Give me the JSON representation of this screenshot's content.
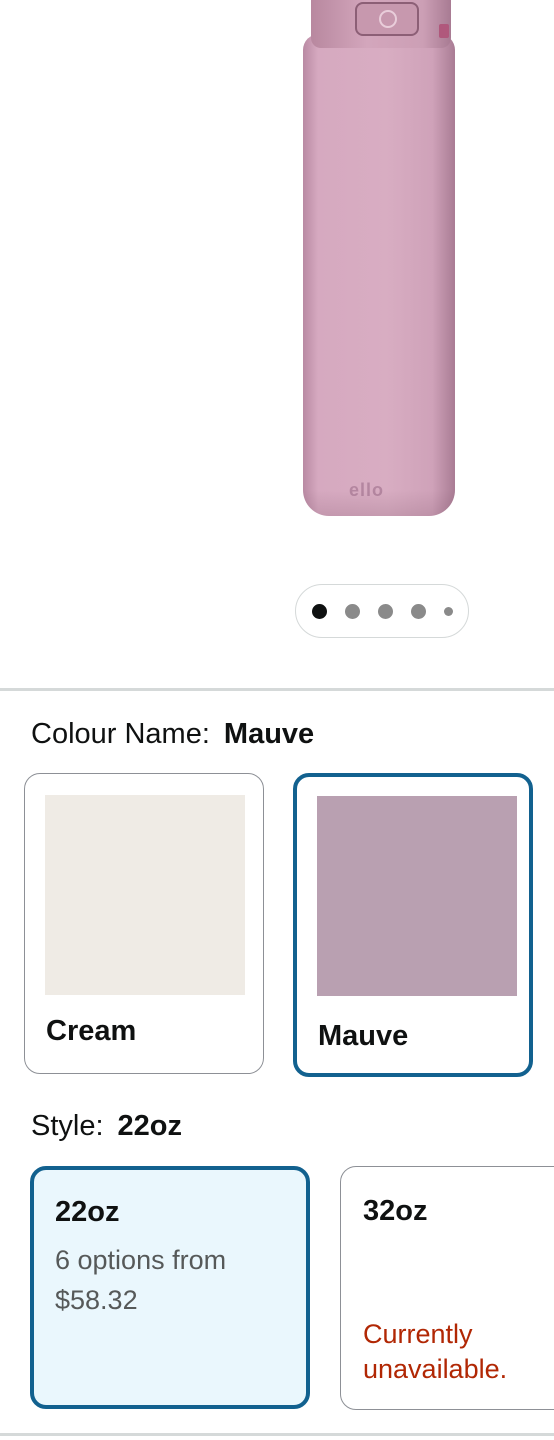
{
  "gallery": {
    "product_image": "mauve water bottle",
    "brand_mark": "ello",
    "page_indicator": {
      "total_dots": 5,
      "active_index": 0
    }
  },
  "colour": {
    "label": "Colour Name:",
    "selected": "Mauve",
    "options": [
      {
        "name": "Cream",
        "color": "#efebe5",
        "selected": false
      },
      {
        "name": "Mauve",
        "color": "#b9a0b1",
        "selected": true
      }
    ]
  },
  "style": {
    "label": "Style:",
    "selected": "22oz",
    "options": [
      {
        "name": "22oz",
        "line1": "6 options from",
        "line2": "$58.32",
        "selected": true
      },
      {
        "name": "32oz",
        "status": "Currently unavailable.",
        "selected": false
      }
    ]
  },
  "colors": {
    "selected_border": "#12618f",
    "selected_bg": "#eaf7fd",
    "unavailable_text": "#b12704"
  }
}
